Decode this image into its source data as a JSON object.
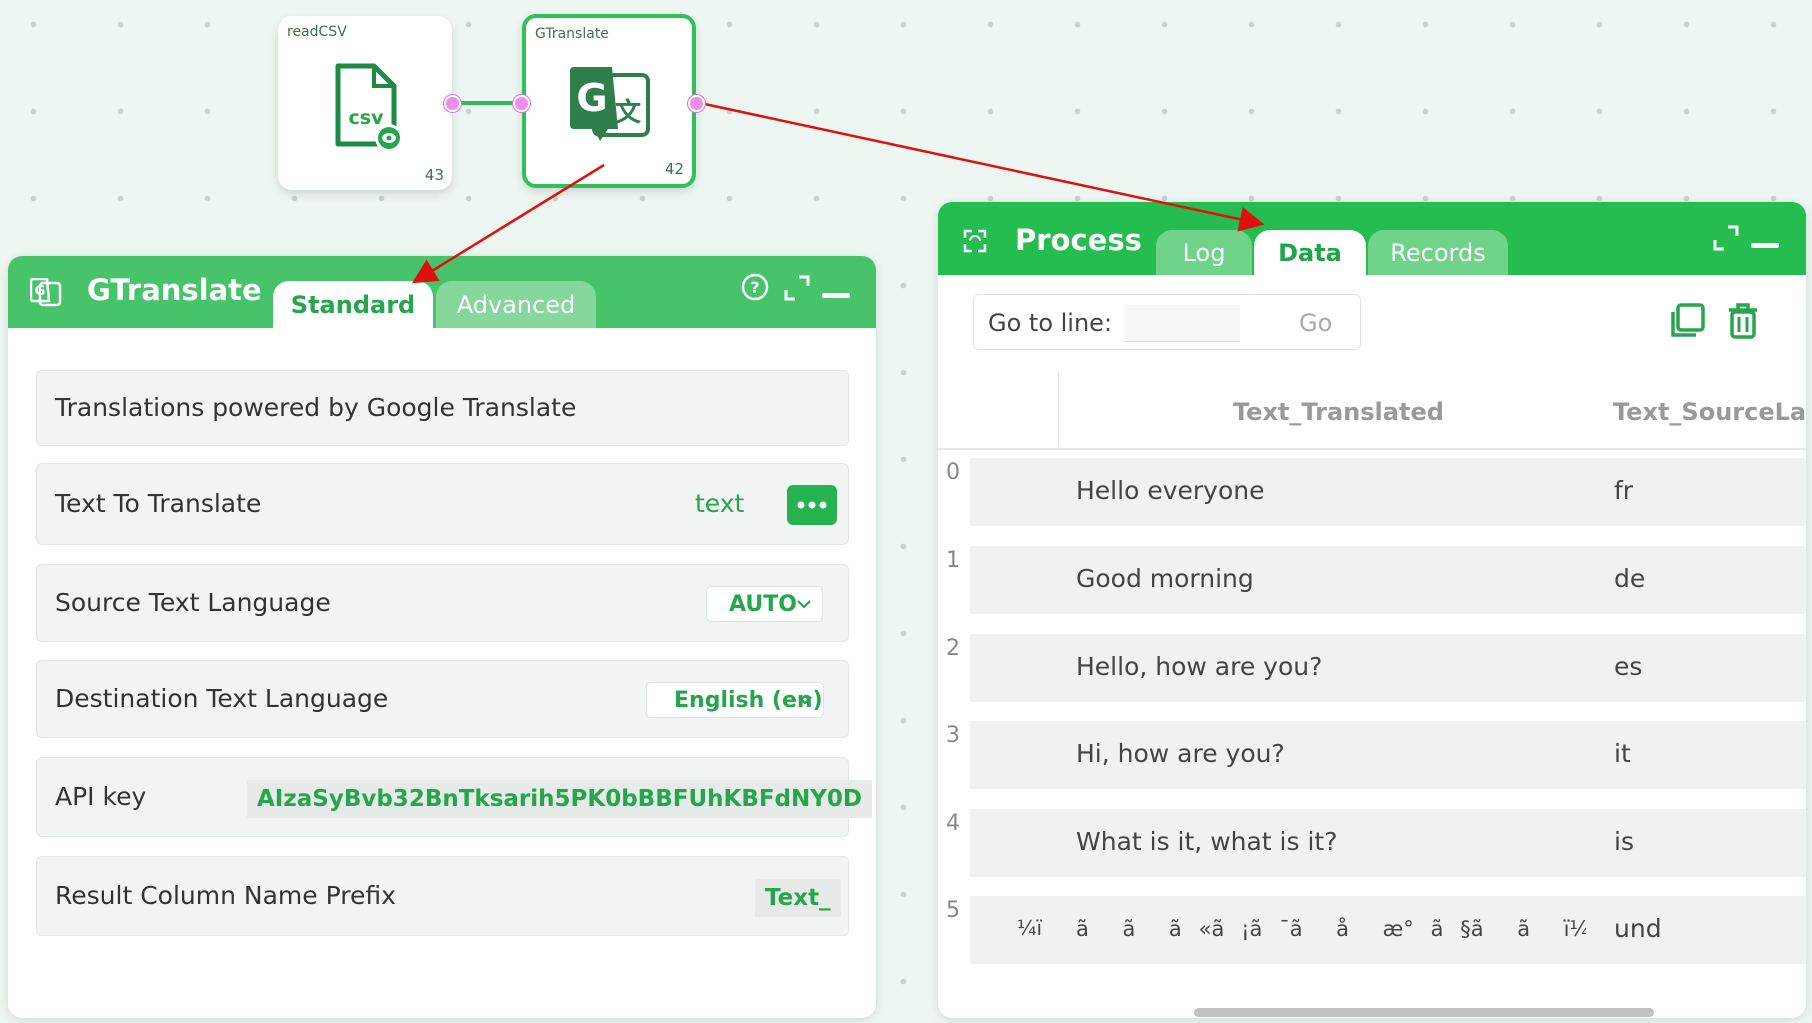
{
  "nodes": {
    "readcsv": {
      "title": "readCSV",
      "count": "43",
      "icon": "csv-file-icon",
      "icon_text": "csv"
    },
    "gtranslate": {
      "title": "GTranslate",
      "count": "42",
      "icon": "google-translate-icon"
    }
  },
  "gtranslate_panel": {
    "title": "GTranslate",
    "tabs": [
      "Standard",
      "Advanced"
    ],
    "info_text": "Translations powered by Google Translate",
    "fields": {
      "text_to_translate": {
        "label": "Text To Translate",
        "value": "text"
      },
      "source_language": {
        "label": "Source Text Language",
        "value": "AUTO"
      },
      "destination_language": {
        "label": "Destination Text Language",
        "value": "English (en)"
      },
      "api_key": {
        "label": "API key",
        "value": "AIzaSyBvb32BnTksarih5PK0bBBFUhKBFdNY0D"
      },
      "result_prefix": {
        "label": "Result Column Name Prefix",
        "value": "Text_"
      }
    }
  },
  "process_panel": {
    "title": "Process",
    "tabs": [
      "Log",
      "Data",
      "Records"
    ],
    "goto_label": "Go to line:",
    "goto_placeholder": "",
    "go_button": "Go",
    "columns": [
      "Text_Translated",
      "Text_SourceLan"
    ],
    "rows": [
      {
        "index": "0",
        "left": "",
        "translated": "Hello everyone",
        "source": "fr"
      },
      {
        "index": "1",
        "left": "",
        "translated": "Good morning",
        "source": "de"
      },
      {
        "index": "2",
        "left": "",
        "translated": "Hello, how are you?",
        "source": "es"
      },
      {
        "index": "3",
        "left": "",
        "translated": "Hi, how are you?",
        "source": "it"
      },
      {
        "index": "4",
        "left": "",
        "translated": "What is it, what is it?",
        "source": "is"
      },
      {
        "index": "5",
        "left": "ï¼",
        "translated": "ããã«ã¡ã¯ãåæ°ã§ããï¼",
        "source": "und"
      }
    ]
  },
  "colors": {
    "header_green": "#47c46a",
    "accent_green": "#26a64c",
    "tab_inactive": "#85d79b",
    "port_pink": "#f08cf0",
    "arrow_red": "#e01010"
  }
}
